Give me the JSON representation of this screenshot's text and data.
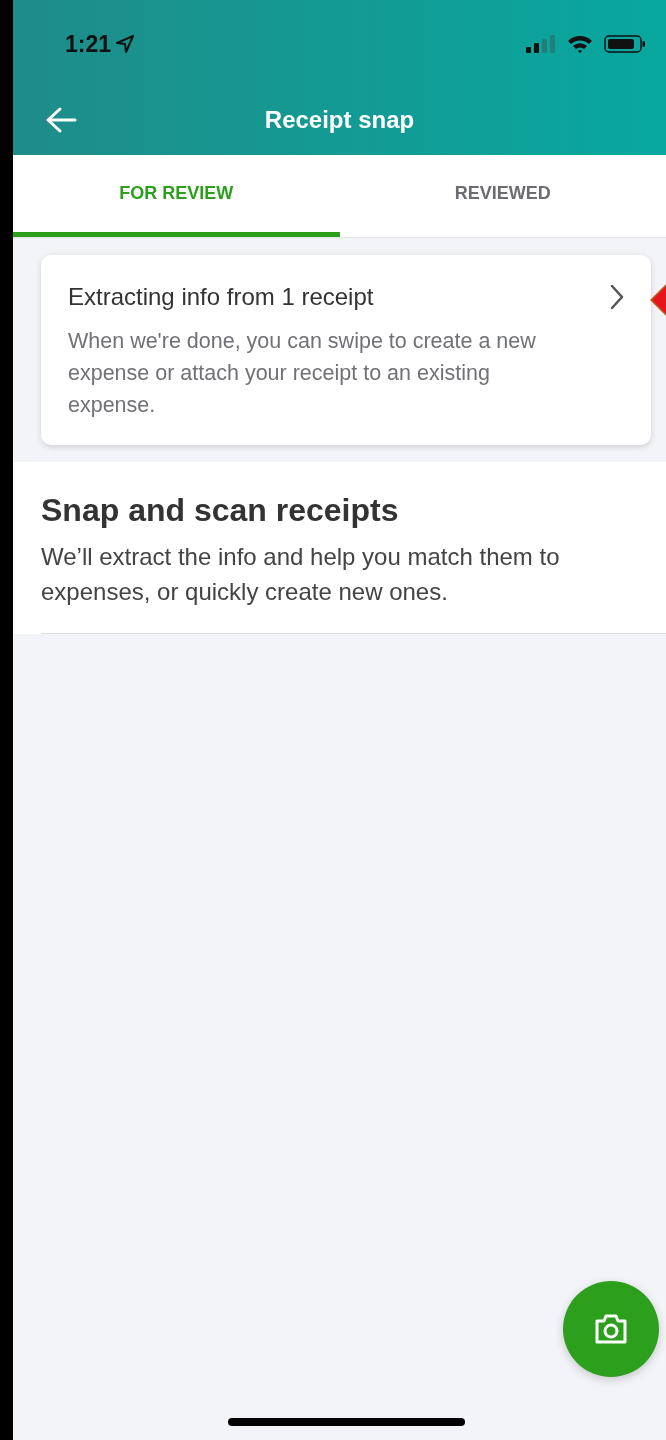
{
  "status_bar": {
    "time": "1:21"
  },
  "header": {
    "title": "Receipt snap"
  },
  "tabs": [
    {
      "label": "FOR REVIEW",
      "selected": true
    },
    {
      "label": "REVIEWED",
      "selected": false
    }
  ],
  "card": {
    "title": "Extracting info from 1 receipt",
    "body": "When we're done, you can swipe to create a new expense or attach your receipt to an existing expense."
  },
  "intro": {
    "heading": "Snap and scan receipts",
    "text": "We’ll extract the info and help you match them to expenses, or quickly create new ones."
  }
}
